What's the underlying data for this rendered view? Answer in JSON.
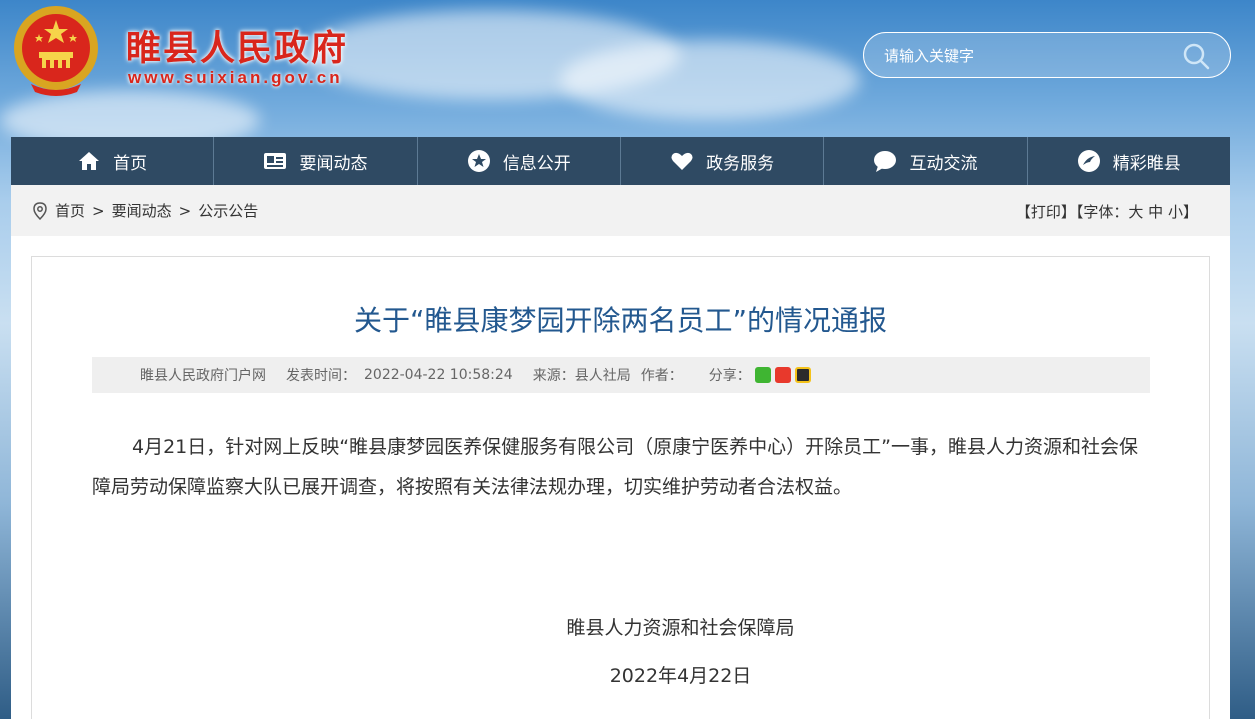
{
  "header": {
    "site_title": "睢县人民政府",
    "site_url": "www.suixian.gov.cn",
    "search_placeholder": "请输入关键字"
  },
  "nav": {
    "items": [
      {
        "label": "首页",
        "icon": "home-icon"
      },
      {
        "label": "要闻动态",
        "icon": "news-card-icon"
      },
      {
        "label": "信息公开",
        "icon": "star-circle-icon"
      },
      {
        "label": "政务服务",
        "icon": "heart-icon"
      },
      {
        "label": "互动交流",
        "icon": "chat-bubble-icon"
      },
      {
        "label": "精彩睢县",
        "icon": "bird-icon"
      }
    ]
  },
  "breadcrumb": {
    "items": [
      "首页",
      "要闻动态",
      "公示公告"
    ],
    "separator": ">"
  },
  "tools": {
    "print": "【打印】",
    "font_prefix": "【字体：",
    "font_large": "大",
    "font_medium": "中",
    "font_small": "小",
    "font_suffix": "】"
  },
  "article": {
    "title": "关于“睢县康梦园开除两名员工”的情况通报",
    "meta": {
      "source_site": "睢县人民政府门户网",
      "publish_label": "发表时间：",
      "publish_time": "2022-04-22 10:58:24",
      "origin": "来源：县人社局",
      "author_label": "作者：",
      "share_label": "分享："
    },
    "body": "4月21日，针对网上反映“睢县康梦园医养保健服务有限公司（原康宁医养中心）开除员工”一事，睢县人力资源和社会保障局劳动保障监察大队已展开调查，将按照有关法律法规办理，切实维护劳动者合法权益。",
    "signature_org": "睢县人力资源和社会保障局",
    "signature_date": "2022年4月22日"
  },
  "colors": {
    "site_red": "#d9261c",
    "nav_bg": "#2f4a63",
    "title_blue": "#23588f"
  }
}
